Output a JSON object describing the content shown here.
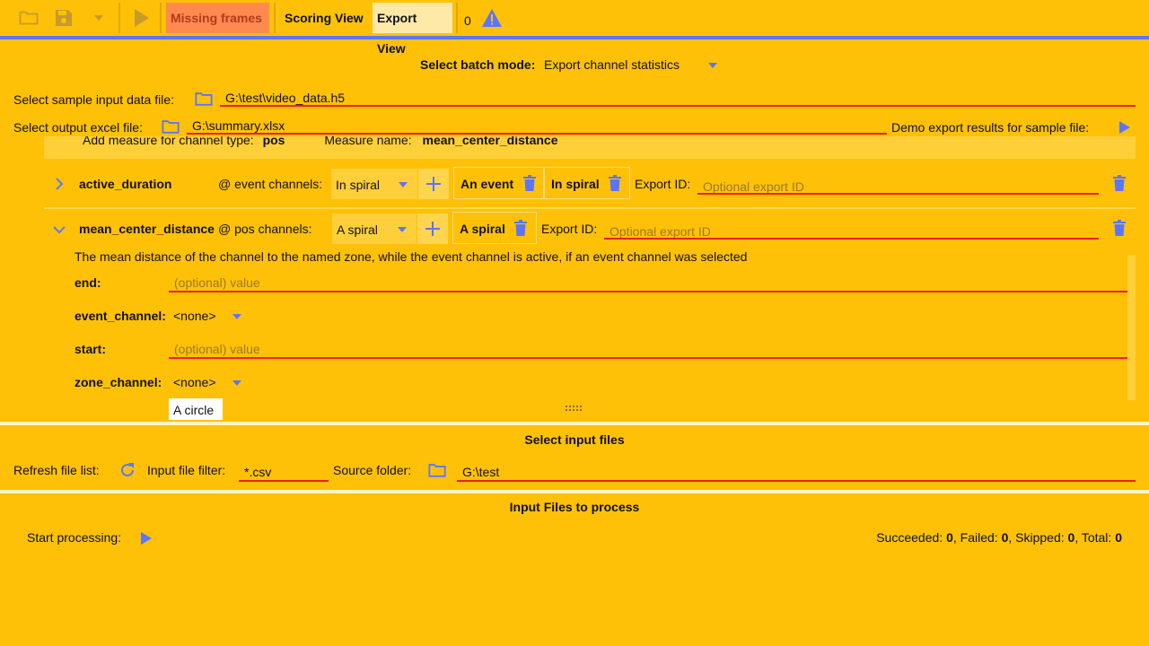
{
  "toolbar": {
    "missing_frames": "Missing frames",
    "scoring_view": "Scoring View",
    "export_view": "Export View",
    "count": "0"
  },
  "batch": {
    "label": "Select batch mode:",
    "value": "Export channel statistics"
  },
  "sample": {
    "label": "Select sample input data file:",
    "value": "G:\\test\\video_data.h5"
  },
  "output": {
    "label": "Select output excel file:",
    "value": "G:\\summary.xlsx",
    "demo_label": "Demo export results for sample file:"
  },
  "partial_row": {
    "text1": "Add measure for channel type:",
    "type": "pos",
    "text2": "Measure name:",
    "name": "mean_center_distance"
  },
  "measures": [
    {
      "name": "active_duration",
      "channel_label": "@ event channels:",
      "select_value": "In spiral",
      "chips": [
        "An event",
        "In spiral"
      ],
      "export_label": "Export ID:",
      "export_placeholder": "Optional export ID"
    },
    {
      "name": "mean_center_distance",
      "channel_label": "@ pos channels:",
      "select_value": "A spiral",
      "chips": [
        "A spiral"
      ],
      "export_label": "Export ID:",
      "export_placeholder": "Optional export ID",
      "description": "The mean distance of the channel to the named zone, while the event channel is active, if an event channel was selected",
      "params": {
        "end_label": "end:",
        "end_placeholder": "(optional) value",
        "event_channel_label": "event_channel:",
        "event_channel_value": "<none>",
        "start_label": "start:",
        "start_placeholder": "(optional) value",
        "zone_channel_label": "zone_channel:",
        "zone_channel_value": "<none>",
        "dropdown_option": "A circle"
      }
    }
  ],
  "files": {
    "title": "Select input files",
    "refresh_label": "Refresh file list:",
    "filter_label": "Input file filter:",
    "filter_value": "*.csv",
    "source_label": "Source folder:",
    "source_value": "G:\\test"
  },
  "process": {
    "title": "Input Files to process",
    "start_label": "Start processing:",
    "succeeded_label": "Succeeded:",
    "succeeded": "0",
    "failed_label": "Failed:",
    "failed": "0",
    "skipped_label": "Skipped:",
    "skipped": "0",
    "total_label": "Total:",
    "total": "0"
  },
  "colors": {
    "background": "#ffc107",
    "accent": "#5b75ff",
    "underline": "#ee2020",
    "missing_frames_bg": "#ff8a50"
  }
}
